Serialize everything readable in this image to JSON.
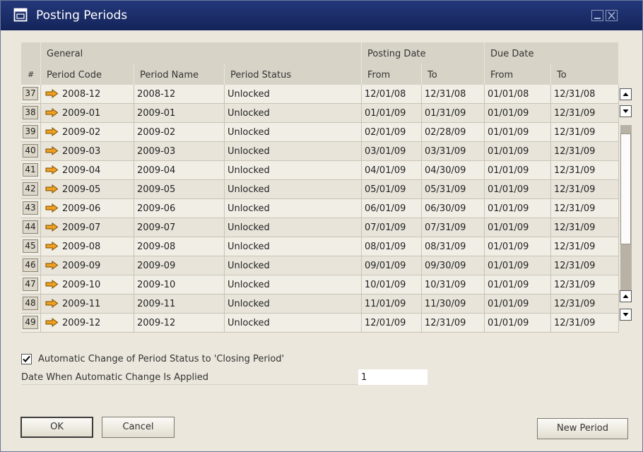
{
  "window": {
    "title": "Posting Periods"
  },
  "table": {
    "group_headers": [
      "General",
      "Posting Date",
      "Due Date"
    ],
    "columns": [
      "#",
      "Period Code",
      "Period Name",
      "Period Status",
      "From",
      "To",
      "From",
      "To"
    ],
    "rows": [
      {
        "num": "37",
        "code": "2008-12",
        "name": "2008-12",
        "status": "Unlocked",
        "post_from": "12/01/08",
        "post_to": "12/31/08",
        "due_from": "01/01/08",
        "due_to": "12/31/08"
      },
      {
        "num": "38",
        "code": "2009-01",
        "name": "2009-01",
        "status": "Unlocked",
        "post_from": "01/01/09",
        "post_to": "01/31/09",
        "due_from": "01/01/09",
        "due_to": "12/31/09"
      },
      {
        "num": "39",
        "code": "2009-02",
        "name": "2009-02",
        "status": "Unlocked",
        "post_from": "02/01/09",
        "post_to": "02/28/09",
        "due_from": "01/01/09",
        "due_to": "12/31/09"
      },
      {
        "num": "40",
        "code": "2009-03",
        "name": "2009-03",
        "status": "Unlocked",
        "post_from": "03/01/09",
        "post_to": "03/31/09",
        "due_from": "01/01/09",
        "due_to": "12/31/09"
      },
      {
        "num": "41",
        "code": "2009-04",
        "name": "2009-04",
        "status": "Unlocked",
        "post_from": "04/01/09",
        "post_to": "04/30/09",
        "due_from": "01/01/09",
        "due_to": "12/31/09"
      },
      {
        "num": "42",
        "code": "2009-05",
        "name": "2009-05",
        "status": "Unlocked",
        "post_from": "05/01/09",
        "post_to": "05/31/09",
        "due_from": "01/01/09",
        "due_to": "12/31/09"
      },
      {
        "num": "43",
        "code": "2009-06",
        "name": "2009-06",
        "status": "Unlocked",
        "post_from": "06/01/09",
        "post_to": "06/30/09",
        "due_from": "01/01/09",
        "due_to": "12/31/09"
      },
      {
        "num": "44",
        "code": "2009-07",
        "name": "2009-07",
        "status": "Unlocked",
        "post_from": "07/01/09",
        "post_to": "07/31/09",
        "due_from": "01/01/09",
        "due_to": "12/31/09"
      },
      {
        "num": "45",
        "code": "2009-08",
        "name": "2009-08",
        "status": "Unlocked",
        "post_from": "08/01/09",
        "post_to": "08/31/09",
        "due_from": "01/01/09",
        "due_to": "12/31/09"
      },
      {
        "num": "46",
        "code": "2009-09",
        "name": "2009-09",
        "status": "Unlocked",
        "post_from": "09/01/09",
        "post_to": "09/30/09",
        "due_from": "01/01/09",
        "due_to": "12/31/09"
      },
      {
        "num": "47",
        "code": "2009-10",
        "name": "2009-10",
        "status": "Unlocked",
        "post_from": "10/01/09",
        "post_to": "10/31/09",
        "due_from": "01/01/09",
        "due_to": "12/31/09"
      },
      {
        "num": "48",
        "code": "2009-11",
        "name": "2009-11",
        "status": "Unlocked",
        "post_from": "11/01/09",
        "post_to": "11/30/09",
        "due_from": "01/01/09",
        "due_to": "12/31/09"
      },
      {
        "num": "49",
        "code": "2009-12",
        "name": "2009-12",
        "status": "Unlocked",
        "post_from": "12/01/09",
        "post_to": "12/31/09",
        "due_from": "01/01/09",
        "due_to": "12/31/09"
      }
    ]
  },
  "auto_change": {
    "checked": true,
    "label": "Automatic Change of Period Status to 'Closing Period'",
    "date_label": "Date When Automatic Change Is Applied",
    "date_value": "1"
  },
  "buttons": {
    "ok": "OK",
    "cancel": "Cancel",
    "new_period": "New Period"
  },
  "colors": {
    "titlebar": "#1a2d68",
    "background": "#ebe7dc",
    "arrow": "#f0a020"
  },
  "icons": {
    "window": "window-icon",
    "row_link": "link-arrow-icon",
    "minimize": "minimize-icon",
    "close": "close-icon"
  }
}
